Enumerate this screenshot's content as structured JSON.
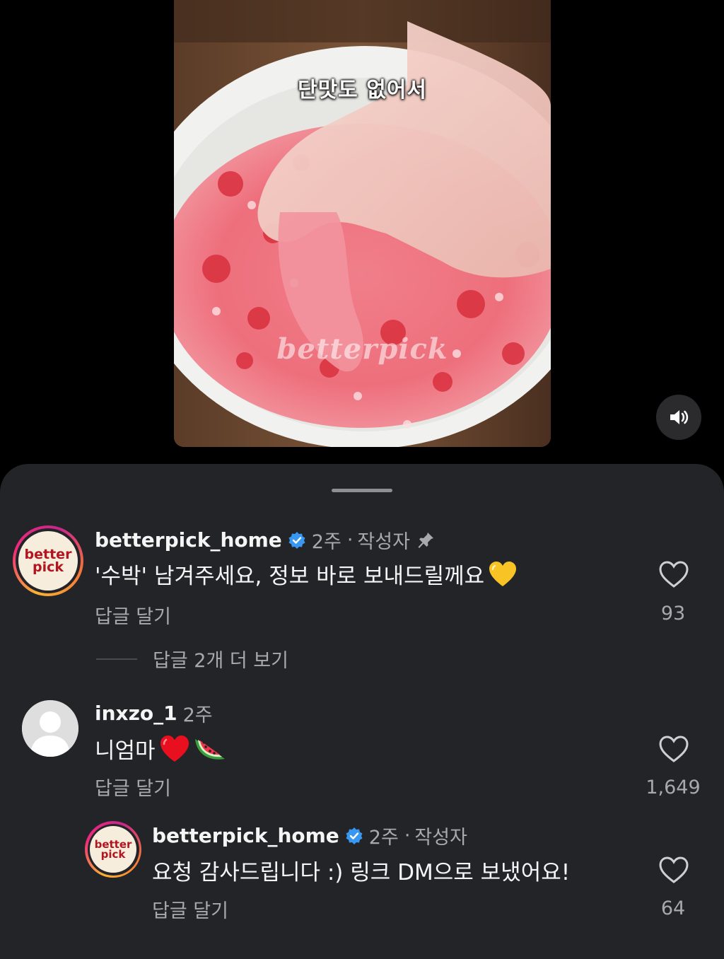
{
  "video": {
    "caption": "단맛도 없어서",
    "watermark": "betterpick",
    "sound_icon": "speaker-icon"
  },
  "comments": [
    {
      "username": "betterpick_home",
      "verified": true,
      "time": "2주",
      "separator": "·",
      "author_tag": "작성자",
      "pinned": true,
      "text": "'수박' 남겨주세요, 정보 바로 보내드릴께요",
      "emoji": "yellow-heart",
      "reply_label": "답글 달기",
      "likes": "93",
      "avatar_line1": "better",
      "avatar_line2": "pick",
      "more_replies": "답글 2개 더 보기"
    },
    {
      "username": "inxzo_1",
      "verified": false,
      "time": "2주",
      "text": "니엄마",
      "emoji": [
        "red-heart",
        "watermelon"
      ],
      "reply_label": "답글 달기",
      "likes": "1,649"
    },
    {
      "username": "betterpick_home",
      "verified": true,
      "time": "2주",
      "separator": "·",
      "author_tag": "작성자",
      "text": "요청 감사드립니다 :) 링크 DM으로 보냈어요!",
      "reply_label": "답글 달기",
      "likes": "64",
      "avatar_line1": "better",
      "avatar_line2": "pick"
    }
  ],
  "colors": {
    "sheet_bg": "#232428",
    "secondary_text": "#a8a8ad",
    "verified_blue": "#3897f0"
  }
}
